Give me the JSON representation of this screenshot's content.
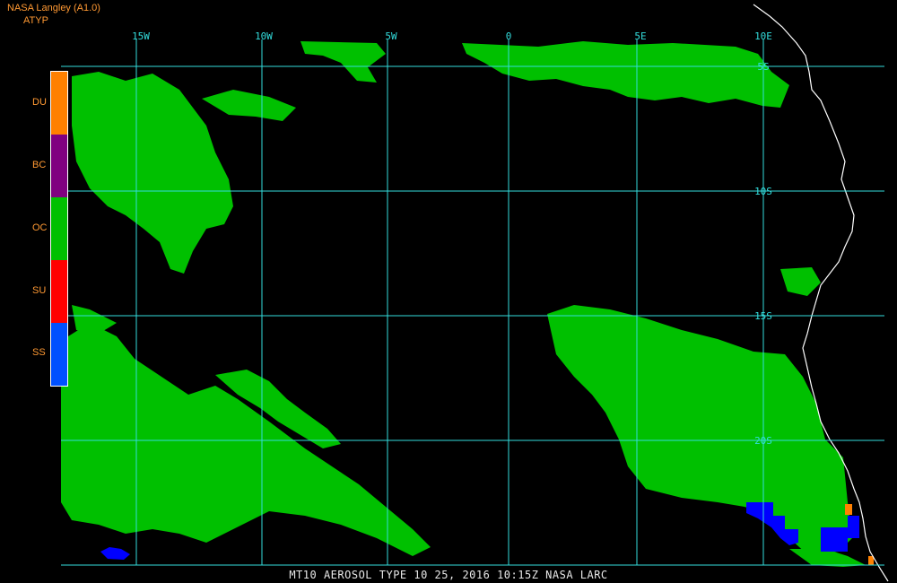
{
  "header": {
    "source": "NASA Langley (A1.0)",
    "product": "ATYP"
  },
  "legend": [
    {
      "code": "DU",
      "color": "#ff8000"
    },
    {
      "code": "BC",
      "color": "#800080"
    },
    {
      "code": "OC",
      "color": "#00c000"
    },
    {
      "code": "SU",
      "color": "#ff0000"
    },
    {
      "code": "SS",
      "color": "#0050ff"
    }
  ],
  "grid": {
    "lon_labels": [
      "15W",
      "10W",
      "5W",
      "0",
      "5E",
      "10E"
    ],
    "lat_labels": [
      "5S",
      "10S",
      "15S",
      "20S"
    ],
    "line_color": "#33dddd"
  },
  "caption": "MT10  AEROSOL TYPE  10 25, 2016 10:15Z  NASA LARC",
  "colors": {
    "background": "#000000",
    "coast": "#ffffff",
    "cloud_aerosol": "#00c000",
    "sea_salt": "#0000ff",
    "dust": "#ff8000"
  }
}
